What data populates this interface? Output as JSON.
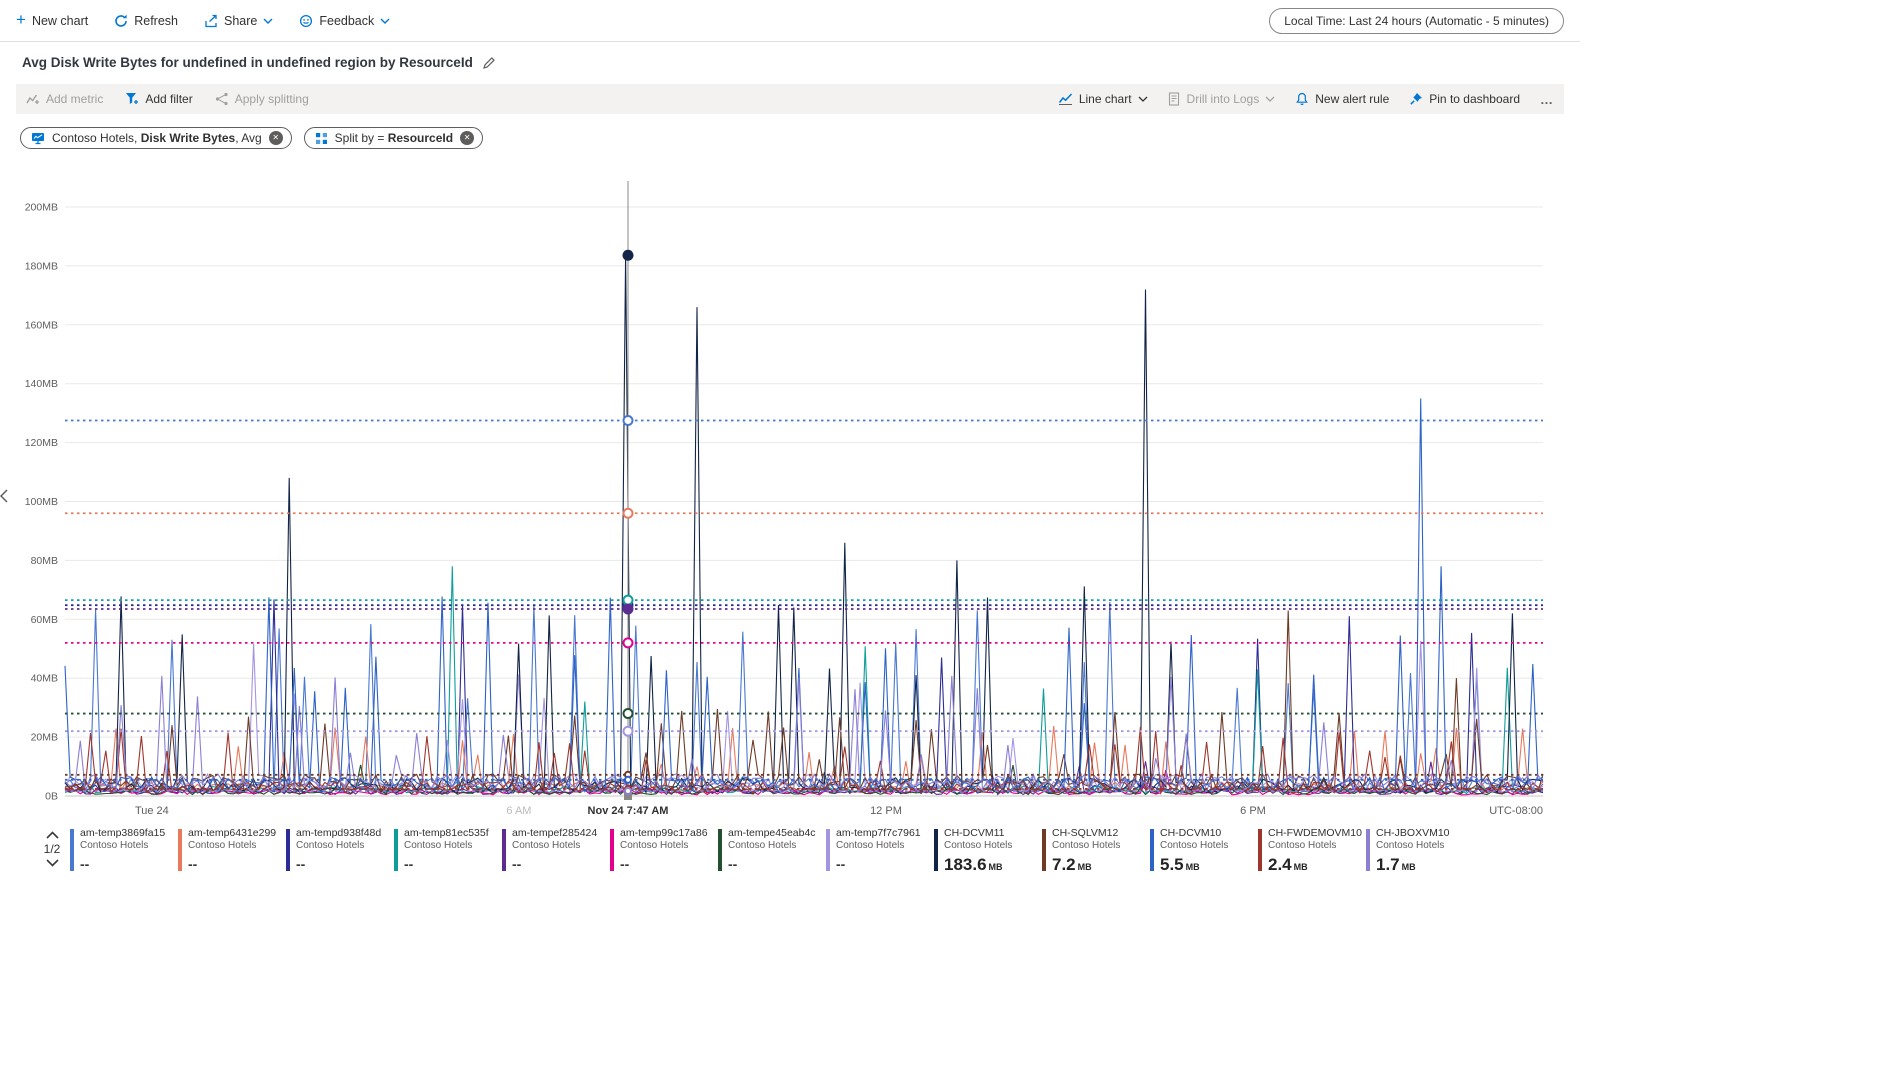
{
  "toolbar": {
    "new_chart_label": "New chart",
    "refresh_label": "Refresh",
    "share_label": "Share",
    "feedback_label": "Feedback",
    "time_range_label": "Local Time: Last 24 hours (Automatic - 5 minutes)"
  },
  "title": {
    "text": "Avg Disk Write Bytes for undefined in undefined region by ResourceId"
  },
  "chart_toolbar": {
    "add_metric": "Add metric",
    "add_filter": "Add filter",
    "apply_splitting": "Apply splitting",
    "line_chart": "Line chart",
    "drill_into_logs": "Drill into Logs",
    "new_alert_rule": "New alert rule",
    "pin_to_dashboard": "Pin to dashboard",
    "more": "…"
  },
  "pills": [
    {
      "prefix": "Contoso Hotels, ",
      "bold": "Disk Write Bytes",
      "suffix": ", Avg"
    },
    {
      "prefix": "Split by = ",
      "bold": "ResourceId",
      "suffix": ""
    }
  ],
  "pagination": {
    "label": "1/2"
  },
  "chart_data": {
    "type": "line",
    "ylim": [
      0,
      200
    ],
    "y_unit": "MB",
    "y_ticks": [
      "0B",
      "20MB",
      "40MB",
      "60MB",
      "80MB",
      "100MB",
      "120MB",
      "140MB",
      "160MB",
      "180MB",
      "200MB"
    ],
    "x_ticks": [
      {
        "label": "Tue 24",
        "hour": 0,
        "muted": false
      },
      {
        "label": "6 AM",
        "hour": 6,
        "muted": true
      },
      {
        "label": "12 PM",
        "hour": 12,
        "muted": false
      },
      {
        "label": "6 PM",
        "hour": 18,
        "muted": false
      }
    ],
    "x_right_label": "UTC-08:00",
    "x_hours_range": [
      -1.42,
      22.74
    ],
    "grid": "horizontal",
    "legend_position": "bottom",
    "crosshair": {
      "label": "Nov 24 7:47 AM",
      "hour": 7.783
    },
    "series": [
      {
        "name": "am-temp3869fa15",
        "company": "Contoso Hotels",
        "color": "#4878d0",
        "legend_value": "--",
        "legend_unit": null,
        "crosshair_mb": 127.5,
        "marker": "ring",
        "no_line": false,
        "profile": {
          "base": 1.2,
          "noise": 5,
          "spike_prob": 0.09,
          "spike_range": [
            28,
            66
          ],
          "peaks": []
        }
      },
      {
        "name": "am-temp6431e299",
        "company": "Contoso Hotels",
        "color": "#e8795c",
        "legend_value": "--",
        "legend_unit": null,
        "crosshair_mb": 96,
        "marker": "ring",
        "no_line": false,
        "profile": {
          "base": 1.0,
          "noise": 4,
          "spike_prob": 0.11,
          "spike_range": [
            10,
            24
          ],
          "peaks": []
        }
      },
      {
        "name": "am-tempd938f48d",
        "company": "Contoso Hotels",
        "color": "#2c2c94",
        "legend_value": "--",
        "legend_unit": null,
        "crosshair_mb": 64.8,
        "marker": "ring",
        "no_line": false,
        "profile": {
          "base": 0.8,
          "noise": 3,
          "spike_prob": 0.025,
          "spike_range": [
            45,
            72
          ],
          "peaks": []
        }
      },
      {
        "name": "am-temp81ec535f",
        "company": "Contoso Hotels",
        "color": "#0e9e99",
        "legend_value": "--",
        "legend_unit": null,
        "crosshair_mb": 66.5,
        "marker": "ring",
        "no_line": false,
        "profile": {
          "base": 0.8,
          "noise": 2.5,
          "spike_prob": 0.012,
          "spike_range": [
            25,
            60
          ],
          "peaks": [
            [
              4.95,
              78
            ],
            [
              18.05,
              43
            ]
          ]
        }
      },
      {
        "name": "am-tempef285424",
        "company": "Contoso Hotels",
        "color": "#5c2d91",
        "legend_value": "--",
        "legend_unit": null,
        "crosshair_mb": 63.5,
        "marker": "dot",
        "no_line": false,
        "profile": {
          "base": 0.5,
          "noise": 2,
          "spike_prob": 0.02,
          "spike_range": [
            5,
            14
          ],
          "peaks": []
        }
      },
      {
        "name": "am-temp99c17a86",
        "company": "Contoso Hotels",
        "color": "#e3008c",
        "legend_value": "--",
        "legend_unit": null,
        "crosshair_mb": 52,
        "marker": "ring",
        "no_line": false,
        "profile": {
          "base": 0.4,
          "noise": 1.8,
          "spike_prob": 0.025,
          "spike_range": [
            4,
            10
          ],
          "peaks": []
        }
      },
      {
        "name": "am-tempe45eab4c",
        "company": "Contoso Hotels",
        "color": "#235030",
        "legend_value": "--",
        "legend_unit": null,
        "crosshair_mb": 28,
        "marker": "ring",
        "no_line": false,
        "profile": {
          "base": 0.5,
          "noise": 2,
          "spike_prob": 0.02,
          "spike_range": [
            4,
            12
          ],
          "peaks": []
        }
      },
      {
        "name": "am-temp7f7c7961",
        "company": "Contoso Hotels",
        "color": "#a495e0",
        "legend_value": "--",
        "legend_unit": null,
        "crosshair_mb": 22,
        "marker": "ring",
        "no_line": false,
        "profile": {
          "base": 1.5,
          "noise": 6,
          "spike_prob": 0.07,
          "spike_range": [
            14,
            63
          ],
          "peaks": []
        }
      },
      {
        "name": "CH-DCVM11",
        "company": "Contoso Hotels",
        "color": "#122447",
        "legend_value": "183.6",
        "legend_unit": "MB",
        "crosshair_mb": 183.6,
        "marker": "dot",
        "no_line": true,
        "profile": {
          "base": 1.2,
          "noise": 5,
          "spike_prob": 0.055,
          "spike_range": [
            40,
            72
          ],
          "peaks": [
            [
              2.25,
              108
            ],
            [
              7.783,
              183.6
            ],
            [
              8.9,
              166
            ],
            [
              11.35,
              86
            ],
            [
              13.2,
              80
            ],
            [
              16.25,
              172
            ]
          ]
        }
      },
      {
        "name": "CH-SQLVM12",
        "company": "Contoso Hotels",
        "color": "#6e3a26",
        "legend_value": "7.2",
        "legend_unit": "MB",
        "crosshair_mb": 7.2,
        "marker": "ring",
        "no_line": false,
        "profile": {
          "base": 1.5,
          "noise": 6,
          "spike_prob": 0.11,
          "spike_range": [
            12,
            30
          ],
          "peaks": [
            [
              18.6,
              63
            ],
            [
              21.3,
              40
            ]
          ]
        }
      },
      {
        "name": "CH-DCVM10",
        "company": "Contoso Hotels",
        "color": "#2d62c6",
        "legend_value": "5.5",
        "legend_unit": "MB",
        "crosshair_mb": 5.5,
        "marker": "ring",
        "no_line": false,
        "profile": {
          "base": 1.5,
          "noise": 5,
          "spike_prob": 0.09,
          "spike_range": [
            25,
            68
          ],
          "peaks": [
            [
              20.75,
              135
            ],
            [
              21.05,
              78
            ]
          ]
        }
      },
      {
        "name": "CH-FWDEMOVM10",
        "company": "Contoso Hotels",
        "color": "#a0352c",
        "legend_value": "2.4",
        "legend_unit": "MB",
        "crosshair_mb": 2.4,
        "marker": "ring",
        "no_line": false,
        "profile": {
          "base": 1.0,
          "noise": 4,
          "spike_prob": 0.09,
          "spike_range": [
            10,
            24
          ],
          "peaks": []
        }
      },
      {
        "name": "CH-JBOXVM10",
        "company": "Contoso Hotels",
        "color": "#8a7fd4",
        "legend_value": "1.7",
        "legend_unit": "MB",
        "crosshair_mb": 1.7,
        "marker": "ring",
        "no_line": false,
        "profile": {
          "base": 1.5,
          "noise": 6,
          "spike_prob": 0.08,
          "spike_range": [
            12,
            42
          ],
          "peaks": []
        }
      }
    ]
  }
}
